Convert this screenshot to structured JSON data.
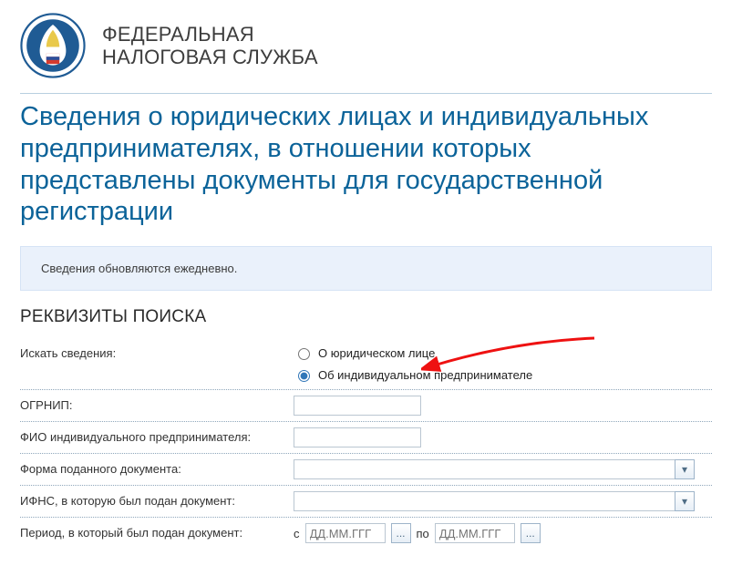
{
  "header": {
    "org_line1": "ФЕДЕРАЛЬНАЯ",
    "org_line2": "НАЛОГОВАЯ СЛУЖБА"
  },
  "page_title": "Сведения о юридических лицах и индивидуальных предпринимателях, в отношении которых представлены документы для государственной регистрации",
  "notice": "Сведения обновляются ежедневно.",
  "section_head": "РЕКВИЗИТЫ ПОИСКА",
  "form": {
    "search_label": "Искать сведения:",
    "radio_legal": "О юридическом лице",
    "radio_individual": "Об индивидуальном предпринимателе",
    "ogrnip_label": "ОГРНИП:",
    "ogrnip_value": "",
    "fio_label": "ФИО индивидуального предпринимателя:",
    "fio_value": "",
    "docform_label": "Форма поданного документа:",
    "docform_value": "",
    "ifns_label": "ИФНС, в которую был подан документ:",
    "ifns_value": "",
    "period_label": "Период, в который был подан документ:",
    "period_from_prefix": "с",
    "period_to_prefix": "по",
    "date_placeholder": "ДД.ММ.ГГГ",
    "date_from": "",
    "date_to": "",
    "chevron": "▾",
    "ellipsis": "..."
  }
}
